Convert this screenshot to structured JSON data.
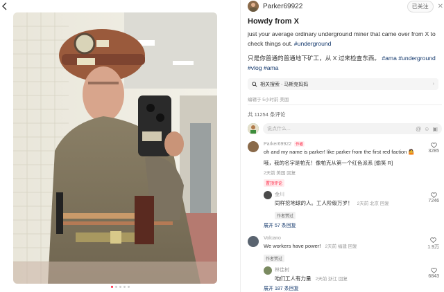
{
  "author": {
    "name": "Parker69922",
    "follow_label": "已关注"
  },
  "post": {
    "title": "Howdy from X",
    "body_en": "just your average ordinary underground miner that came over from X to check things out.",
    "tag_en": "#underground",
    "body_cn": "只是你普通的普通地下矿工，从 X 过来检查东西。",
    "tags_cn": [
      "#ama",
      "#underground",
      "#vlog",
      "#ama"
    ]
  },
  "related_search": {
    "label": "相关搜索 · 马斯克妈妈"
  },
  "meta": {
    "edited": "编辑于 5小时前 美国"
  },
  "comments_total": "共 11254 条评论",
  "comment_input": {
    "placeholder": "说点什么..."
  },
  "comments": [
    {
      "author": "Parker69922",
      "author_tag": "作者",
      "text": "oh and my name is parker! like parker from the first red faction 🤷",
      "translation": "哦，我的名字是帕克！像帕克从第一个红色派系 [偷笑 R]",
      "meta": "2天前 美国 回复",
      "badge": "置顶评论",
      "likes": "3285",
      "reply": {
        "author": "金川",
        "text": "同样挖地球的人。工人阶级万岁！",
        "meta": "2天前 北京 回复",
        "badge": "作者赞过",
        "likes": "7246"
      },
      "expand": "展开 57 条回复"
    },
    {
      "author": "Volcano",
      "text": "We workers have power!",
      "meta": "2天前 福建 回复",
      "badge": "作者赞过",
      "likes": "1.9万",
      "reply": {
        "author": "林佳树",
        "text": "咱们工人有力量",
        "meta": "2天前 浙江 回复",
        "likes": "6843"
      },
      "expand": "展开 187 条回复"
    }
  ],
  "colors": {
    "accent": "#ff2442",
    "tag": "#13386c"
  },
  "icons": [
    "back-icon",
    "search-icon",
    "chevron-right-icon",
    "heart-icon",
    "at-icon",
    "emoji-icon",
    "image-icon",
    "close-icon"
  ]
}
